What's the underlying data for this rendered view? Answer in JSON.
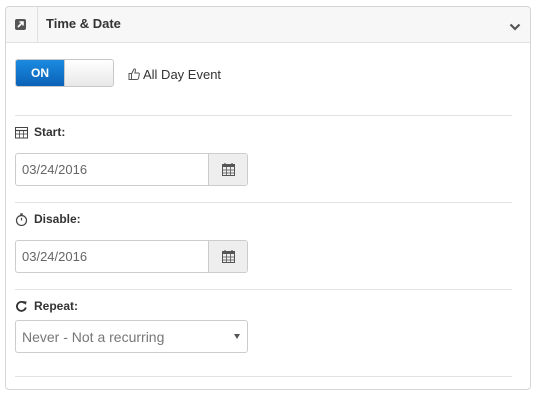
{
  "panel": {
    "title": "Time & Date",
    "header_icon": "external-link-square-icon",
    "collapse_icon": "chevron-down-icon"
  },
  "all_day": {
    "toggle_state": "ON",
    "label": "All Day Event",
    "icon": "thumbs-up-icon",
    "accent_color": "#0b72cf"
  },
  "start": {
    "label": "Start:",
    "icon": "calendar-table-icon",
    "value": "03/24/2016",
    "button_icon": "calendar-icon"
  },
  "disable": {
    "label": "Disable:",
    "icon": "stopwatch-icon",
    "value": "03/24/2016",
    "button_icon": "calendar-icon"
  },
  "repeat": {
    "label": "Repeat:",
    "icon": "refresh-icon",
    "selected": "Never - Not a recurring"
  }
}
